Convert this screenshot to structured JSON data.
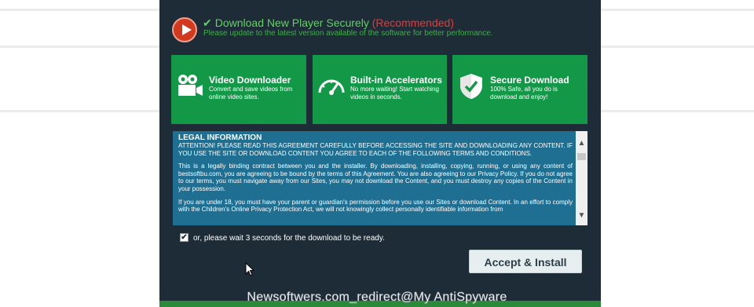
{
  "header": {
    "title": "Download New Player Securely",
    "recommended": "(Recommended)",
    "subtitle": "Please update to the latest version available of the software for better performance."
  },
  "features": [
    {
      "title": "Video Downloader",
      "description": "Convert and save videos from online video sites.",
      "icon": "video-camera-icon"
    },
    {
      "title": "Built-in Accelerators",
      "description": "No more waiting! Start watching videos in seconds.",
      "icon": "speedometer-icon"
    },
    {
      "title": "Secure Download",
      "description": "100% Safe, all you do is download and enjoy!",
      "icon": "shield-check-icon"
    }
  ],
  "legal": {
    "heading": "LEGAL INFORMATION",
    "paragraph1": "ATTENTION! PLEASE READ THIS AGREEMENT CAREFULLY BEFORE ACCESSING THE SITE AND DOWNLOADING ANY CONTENT. IF YOU USE THE SITE OR DOWNLOAD CONTENT YOU AGREE TO EACH OF THE FOLLOWING TERMS AND CONDITIONS.",
    "paragraph2": "This is a legally binding contract between you and the installer. By downloading, installing, copying, running, or using any content of bestsoftbu.com, you are agreeing to be bound by the terms of this Agreement. You are also agreeing to our Privacy Policy. If you do not agree to our terms, you must navigate away from our Sites, you may not download the Content, and you must destroy any copies of the Content in your possession.",
    "paragraph3": "If you are under 18, you must have your parent or guardian's permission before you use our Sites or download Content. In an effort to comply with the Children's Online Privacy Protection Act, we will not knowingly collect personally identifiable information from"
  },
  "wait_checkbox": {
    "checked": true,
    "label": "or, please wait 3 seconds for the download to be ready."
  },
  "accept_button": "Accept & Install",
  "watermark": "Newsoftwers.com_redirect@My AntiSpyware",
  "colors": {
    "panel": "#1d2c36",
    "feature_green": "#139848",
    "legal_blue": "#1f6f93",
    "recommended_red": "#e03c3c"
  }
}
